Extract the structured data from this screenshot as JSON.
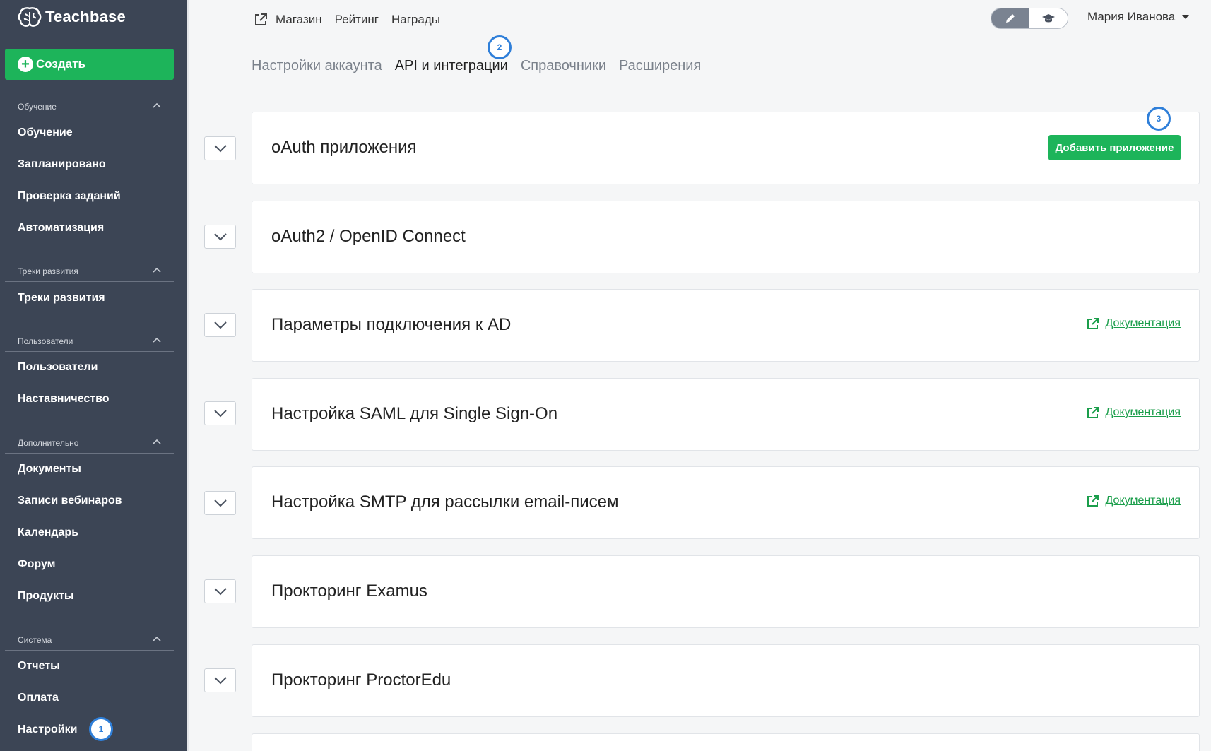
{
  "sidebar": {
    "logo_text": "Teachbase",
    "create_label": "Создать",
    "sections": [
      {
        "title": "Обучение",
        "items": [
          "Обучение",
          "Запланировано",
          "Проверка заданий",
          "Автоматизация"
        ]
      },
      {
        "title": "Треки развития",
        "items": [
          "Треки развития"
        ]
      },
      {
        "title": "Пользователи",
        "items": [
          "Пользователи",
          "Наставничество"
        ]
      },
      {
        "title": "Дополнительно",
        "items": [
          "Документы",
          "Записи вебинаров",
          "Календарь",
          "Форум",
          "Продукты"
        ]
      },
      {
        "title": "Система",
        "items": [
          "Отчеты",
          "Оплата",
          "Настройки"
        ]
      }
    ]
  },
  "topnav": {
    "links": [
      "Магазин",
      "Рейтинг",
      "Награды"
    ],
    "user_name": "Мария Иванова"
  },
  "tabs": [
    "Настройки аккаунта",
    "API и интеграции",
    "Справочники",
    "Расширения"
  ],
  "active_tab": "API и интеграции",
  "badges": [
    "1",
    "2",
    "3"
  ],
  "panels": [
    {
      "title": "oAuth приложения",
      "action": "Добавить приложение"
    },
    {
      "title": "oAuth2 / OpenID Connect"
    },
    {
      "title": "Параметры подключения к AD",
      "doc": "Документация"
    },
    {
      "title": "Настройка SAML для Single Sign-On",
      "doc": "Документация"
    },
    {
      "title": "Настройка SMTP для рассылки email-писем",
      "doc": "Документация"
    },
    {
      "title": "Прокторинг Examus"
    },
    {
      "title": "Прокторинг ProctorEdu"
    }
  ],
  "colors": {
    "accent": "#1db45a",
    "sidebar": "#3c4555",
    "badge": "#2f7fd9",
    "link": "#1b9e4b"
  }
}
